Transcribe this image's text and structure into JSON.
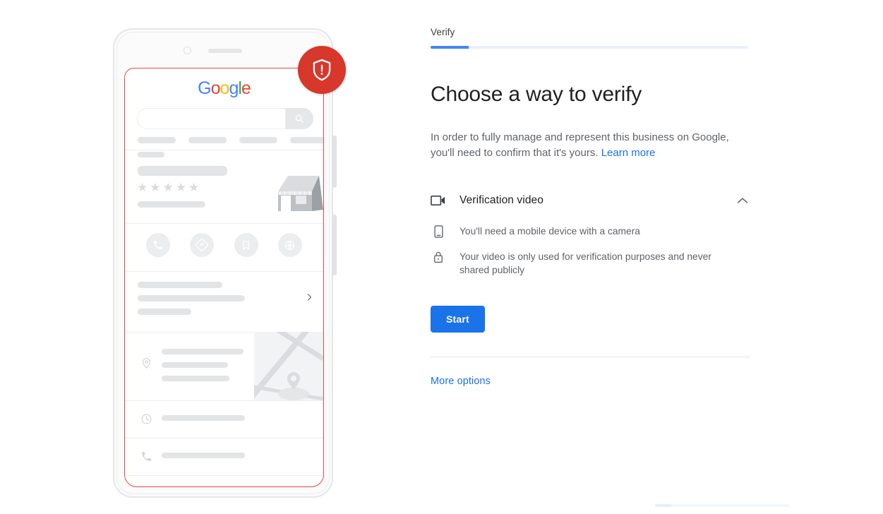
{
  "progress": {
    "label": "Verify",
    "percent": 12,
    "fill_color": "#4285f4",
    "track_color": "#e8f0fe"
  },
  "main": {
    "headline": "Choose a way to verify",
    "intro_text": "In order to fully manage and represent this business on Google, you'll need to confirm that it's yours.",
    "learn_more_label": "Learn more"
  },
  "option": {
    "title": "Verification video",
    "icon": "video-camera-icon",
    "collapse_icon": "chevron-up-icon",
    "bullets": [
      {
        "icon": "smartphone-icon",
        "text": "You'll need a mobile device with a camera"
      },
      {
        "icon": "lock-icon",
        "text": "Your video is only used for verification purposes and never shared publicly"
      }
    ],
    "start_label": "Start",
    "start_color": "#1a73e8"
  },
  "footer": {
    "more_options_label": "More options",
    "link_color": "#1a73e8"
  },
  "illustration": {
    "badge": {
      "icon": "shield-alert-icon",
      "color": "#d8372b"
    },
    "highlight_color": "#e8473f",
    "google_logo": [
      "G",
      "o",
      "o",
      "g",
      "l",
      "e"
    ],
    "search_placeholder": "",
    "search_icon": "search-icon",
    "rating_stars": 5,
    "action_icons": [
      "phone-icon",
      "directions-icon",
      "bookmark-icon",
      "website-icon"
    ],
    "info_rows": [
      {
        "icon": "location-pin-icon"
      },
      {
        "icon": "clock-icon"
      },
      {
        "icon": "phone-handset-icon"
      },
      {
        "icon": "globe-icon"
      }
    ],
    "storefront": "storefront-illustration",
    "map": "map-thumbnail"
  },
  "bottom": {
    "progress_percent": 12
  }
}
